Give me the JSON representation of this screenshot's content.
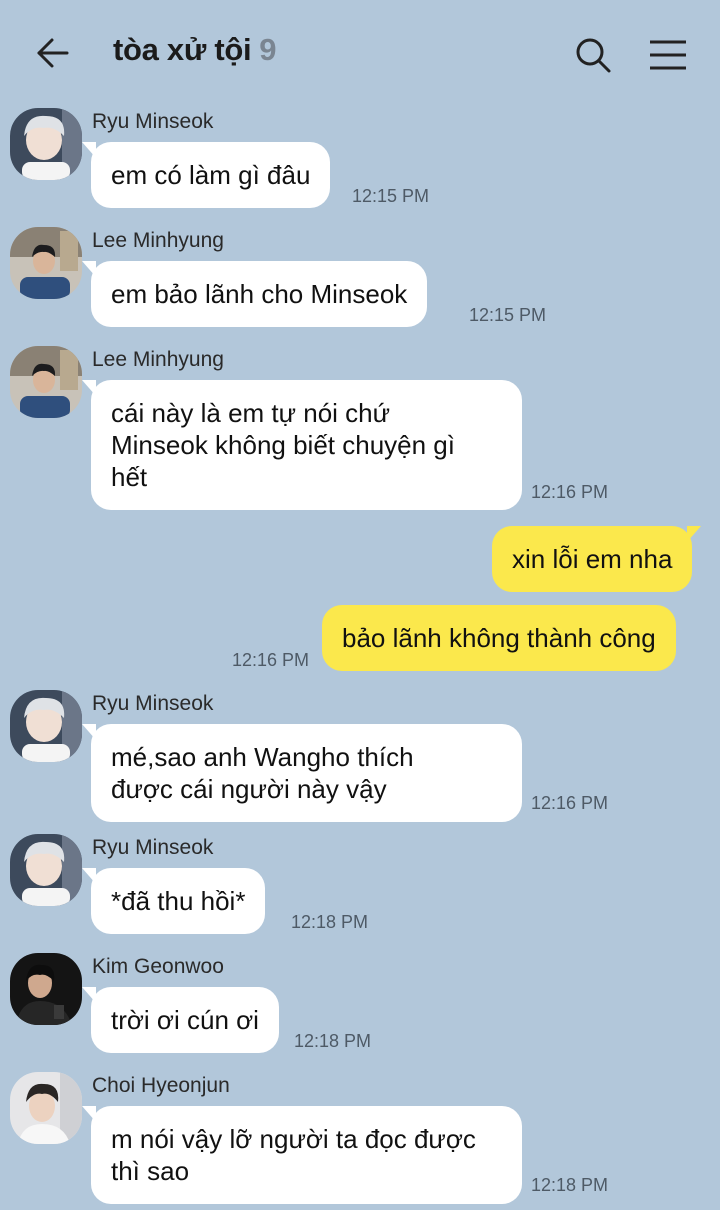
{
  "header": {
    "title": "tòa xử tội",
    "member_count": "9",
    "back_icon": "arrow-left-icon",
    "search_icon": "search-icon",
    "menu_icon": "hamburger-menu-icon"
  },
  "messages": [
    {
      "sender": "Ryu Minseok",
      "lines": [
        "em có làm gì đâu"
      ],
      "time": "12:15 PM"
    },
    {
      "sender": "Lee Minhyung",
      "lines": [
        "em bảo lãnh cho Minseok"
      ],
      "time": "12:15 PM"
    },
    {
      "sender": "Lee Minhyung",
      "lines": [
        "cái này là em tự nói chứ",
        "Minseok không biết chuyện gì",
        "hết"
      ],
      "time": "12:16 PM"
    },
    {
      "lines": [
        "xin lỗi em nha"
      ]
    },
    {
      "lines": [
        "bảo lãnh không thành công"
      ],
      "time": "12:16 PM"
    },
    {
      "sender": "Ryu Minseok",
      "lines": [
        "mé,sao anh Wangho thích",
        "được cái người này vậy"
      ],
      "time": "12:16 PM"
    },
    {
      "sender": "Ryu Minseok",
      "lines": [
        "*đã thu hồi*"
      ],
      "time": "12:18 PM"
    },
    {
      "sender": "Kim Geonwoo",
      "lines": [
        "trời ơi cún ơi"
      ],
      "time": "12:18 PM"
    },
    {
      "sender": "Choi Hyeonjun",
      "lines": [
        "m nói vậy lỡ người ta đọc được",
        "thì sao"
      ],
      "time": "12:18 PM"
    }
  ],
  "colors": {
    "background": "#b2c7da",
    "incoming_bubble": "#ffffff",
    "outgoing_bubble": "#fbe84c"
  }
}
